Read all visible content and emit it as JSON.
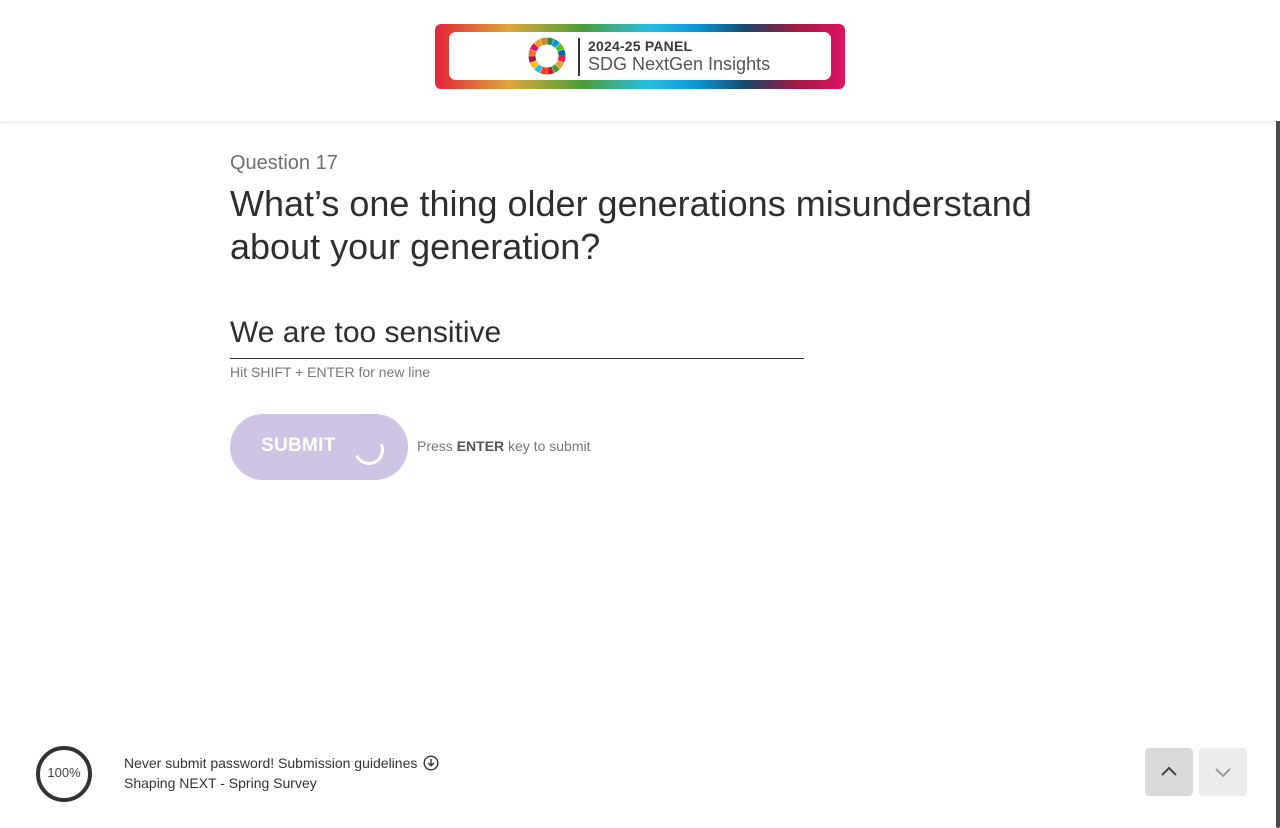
{
  "header": {
    "logo": {
      "line1_year": "2024-25",
      "line1_word": "PANEL",
      "line2": "SDG NextGen Insights"
    }
  },
  "question": {
    "number_label": "Question 17",
    "title": "What’s one thing older generations misunderstand about your generation?"
  },
  "answer": {
    "value": "We are too sensitive",
    "hint": "Hit SHIFT + ENTER for new line"
  },
  "submit": {
    "label": "SUBMIT",
    "hint_prefix": "Press",
    "hint_key": "ENTER",
    "hint_suffix": "key to submit"
  },
  "footer": {
    "progress": {
      "value": 1.0,
      "label": "100%"
    },
    "notice": "Never submit password! Submission guidelines",
    "survey_name": "Shaping NEXT - Spring Survey"
  },
  "icons": {
    "guidelines": "download-circle-icon",
    "nav_up": "chevron-up-icon",
    "nav_down": "chevron-down-icon",
    "submit_spinner": "spinner-icon"
  },
  "colors": {
    "submit_bg": "#cfc4e4",
    "text": "#2f2f2f",
    "progress_ring": "#333333"
  }
}
